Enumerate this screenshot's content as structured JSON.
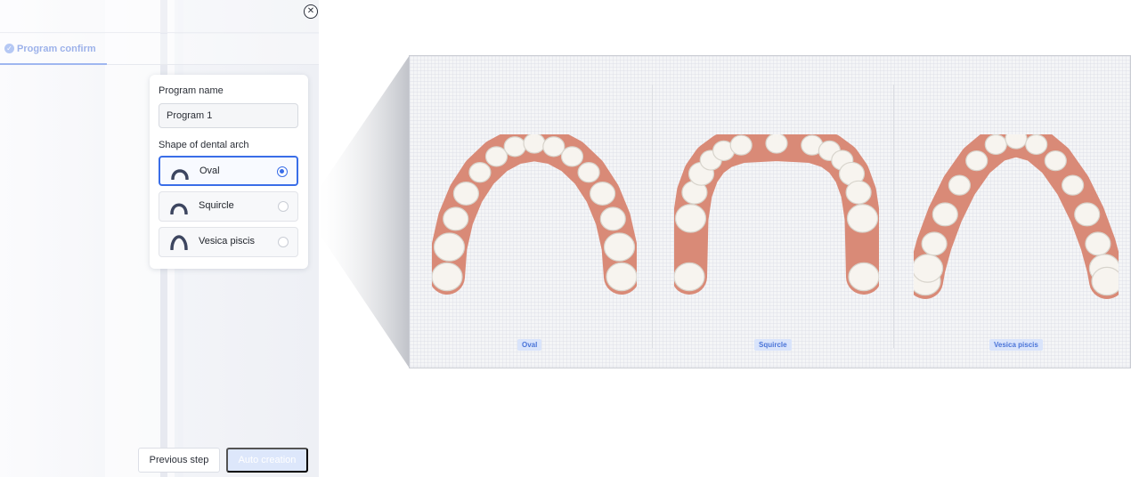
{
  "window": {
    "close_icon": "close-icon"
  },
  "tabs": [
    {
      "label": "Program confirm",
      "icon": "step-circle-icon"
    }
  ],
  "form": {
    "program_name_label": "Program name",
    "program_name_value": "Program 1",
    "arch_shape_label": "Shape of dental arch",
    "options": [
      {
        "label": "Oval",
        "selected": true,
        "icon": "arch-shape-icon"
      },
      {
        "label": "Squircle",
        "selected": false,
        "icon": "arch-shape-icon"
      },
      {
        "label": "Vesica piscis",
        "selected": false,
        "icon": "arch-shape-icon"
      }
    ]
  },
  "footer": {
    "previous_label": "Previous step",
    "auto_label": "Auto creation"
  },
  "preview": {
    "labels": [
      "Oval",
      "Squircle",
      "Vesica piscis"
    ]
  },
  "colors": {
    "accent": "#3a6ee8",
    "gum": "#d98a77",
    "tooth": "#f7f4ef"
  }
}
